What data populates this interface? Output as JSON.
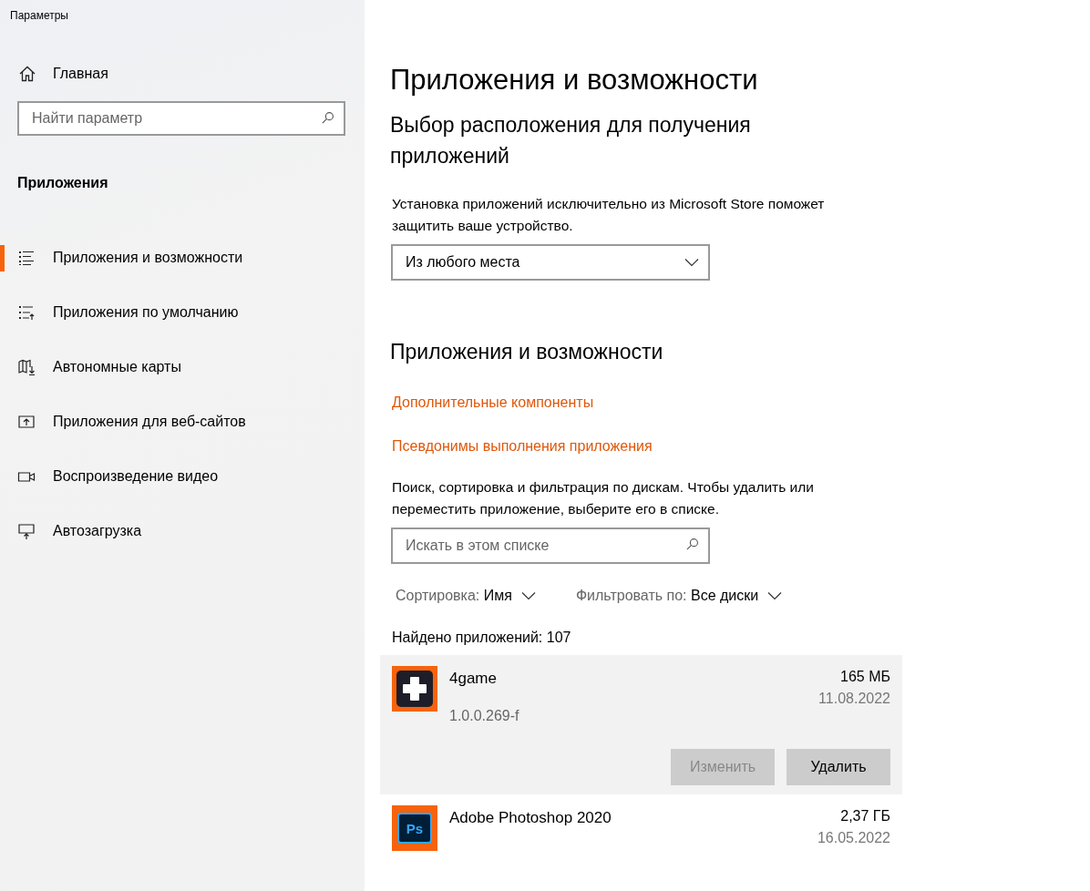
{
  "window": {
    "title": "Параметры"
  },
  "sidebar": {
    "home": "Главная",
    "search": {
      "placeholder": "Найти параметр"
    },
    "section": "Приложения",
    "items": [
      {
        "label": "Приложения и возможности",
        "kind": "list",
        "selected": true
      },
      {
        "label": "Приложения по умолчанию",
        "kind": "default-list",
        "selected": false
      },
      {
        "label": "Автономные карты",
        "kind": "map",
        "selected": false
      },
      {
        "label": "Приложения для веб-сайтов",
        "kind": "web",
        "selected": false
      },
      {
        "label": "Воспроизведение видео",
        "kind": "video",
        "selected": false
      },
      {
        "label": "Автозагрузка",
        "kind": "startup",
        "selected": false
      }
    ]
  },
  "main": {
    "title": "Приложения и возможности",
    "source": {
      "heading": "Выбор расположения для получения приложений",
      "description": "Установка приложений исключительно из Microsoft Store поможет защитить ваше устройство.",
      "dropdown": "Из любого места"
    },
    "apps_section": {
      "heading": "Приложения и возможности",
      "links": [
        "Дополнительные компоненты",
        "Псевдонимы выполнения приложения"
      ],
      "description": "Поиск, сортировка и фильтрация по дискам. Чтобы удалить или переместить приложение, выберите его в списке.",
      "search": {
        "placeholder": "Искать в этом списке"
      },
      "sort": {
        "label": "Сортировка:",
        "value": "Имя"
      },
      "filter": {
        "label": "Фильтровать по:",
        "value": "Все диски"
      },
      "count": "Найдено приложений: 107",
      "apps": [
        {
          "name": "4game",
          "kind": "cross-logo",
          "size": "165 МБ",
          "date": "11.08.2022",
          "version": "1.0.0.269-f",
          "selected": true,
          "buttons": [
            {
              "label": "Изменить",
              "disabled": true
            },
            {
              "label": "Удалить",
              "disabled": false
            }
          ]
        },
        {
          "name": "Adobe Photoshop 2020",
          "kind": "ps-logo",
          "icon_text": "Ps",
          "size": "2,37 ГБ",
          "date": "16.05.2022",
          "selected": false
        }
      ]
    }
  }
}
